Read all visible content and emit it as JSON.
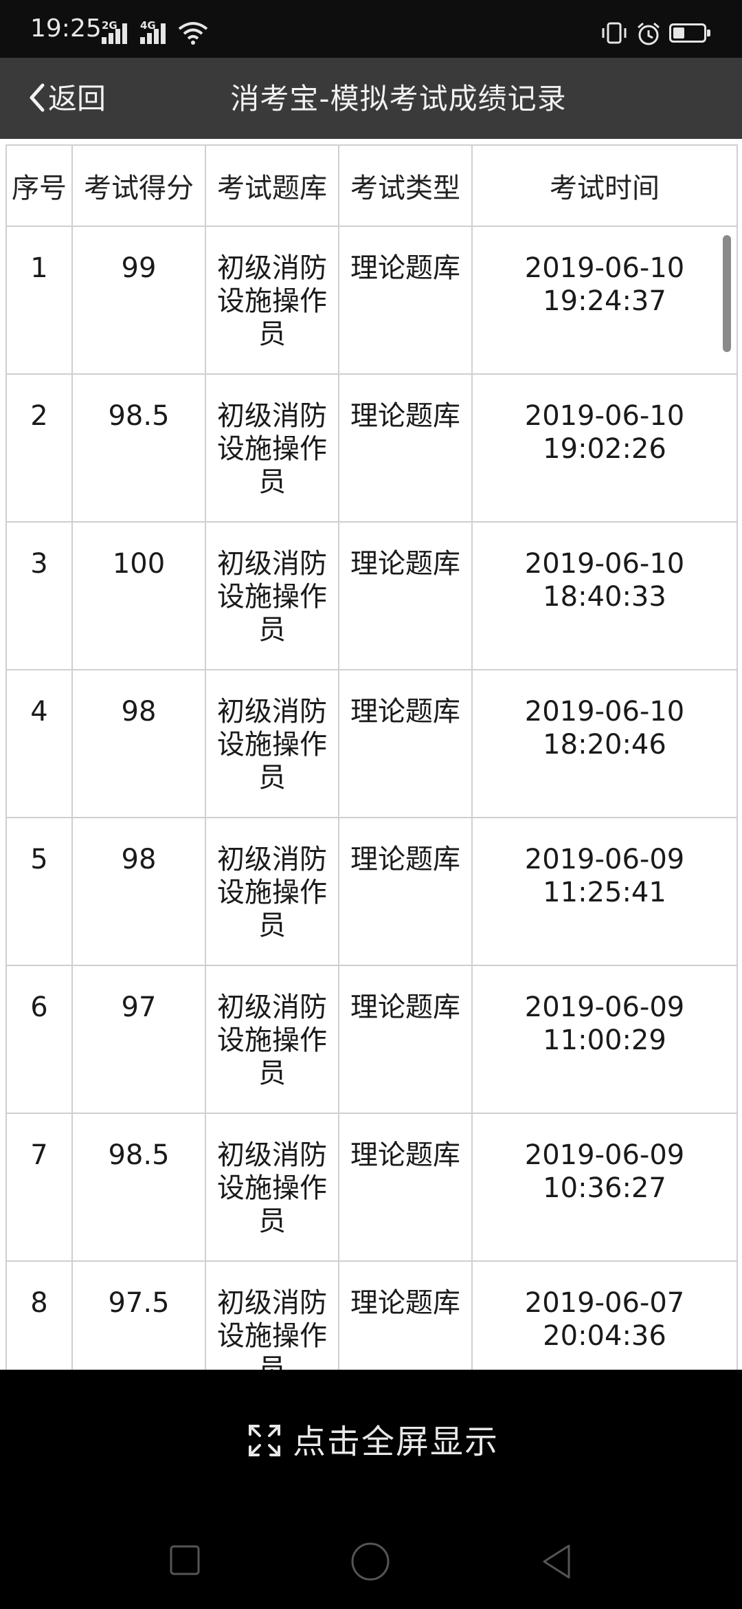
{
  "status_bar": {
    "time": "19:25",
    "net1": "2G",
    "net2": "4G",
    "icons": [
      "signal-icon",
      "wifi-icon",
      "vibrate-icon",
      "alarm-icon",
      "battery-icon"
    ]
  },
  "header": {
    "back_label": "返回",
    "title": "消考宝-模拟考试成绩记录"
  },
  "table": {
    "columns": [
      "序号",
      "考试得分",
      "考试题库",
      "考试类型",
      "考试时间"
    ],
    "rows": [
      {
        "no": "1",
        "score": "99",
        "bank": "初级消防设施操作员",
        "type": "理论题库",
        "date": "2019-06-10",
        "time": "19:24:37"
      },
      {
        "no": "2",
        "score": "98.5",
        "bank": "初级消防设施操作员",
        "type": "理论题库",
        "date": "2019-06-10",
        "time": "19:02:26"
      },
      {
        "no": "3",
        "score": "100",
        "bank": "初级消防设施操作员",
        "type": "理论题库",
        "date": "2019-06-10",
        "time": "18:40:33"
      },
      {
        "no": "4",
        "score": "98",
        "bank": "初级消防设施操作员",
        "type": "理论题库",
        "date": "2019-06-10",
        "time": "18:20:46"
      },
      {
        "no": "5",
        "score": "98",
        "bank": "初级消防设施操作员",
        "type": "理论题库",
        "date": "2019-06-09",
        "time": "11:25:41"
      },
      {
        "no": "6",
        "score": "97",
        "bank": "初级消防设施操作员",
        "type": "理论题库",
        "date": "2019-06-09",
        "time": "11:00:29"
      },
      {
        "no": "7",
        "score": "98.5",
        "bank": "初级消防设施操作员",
        "type": "理论题库",
        "date": "2019-06-09",
        "time": "10:36:27"
      },
      {
        "no": "8",
        "score": "97.5",
        "bank": "初级消防设施操作员",
        "type": "理论题库",
        "date": "2019-06-07",
        "time": "20:04:36"
      }
    ]
  },
  "fullscreen": {
    "label": "点击全屏显示",
    "icon": "expand-arrows-icon"
  },
  "nav": {
    "icons": [
      "recent-apps-icon",
      "home-icon",
      "back-triangle-icon"
    ]
  }
}
